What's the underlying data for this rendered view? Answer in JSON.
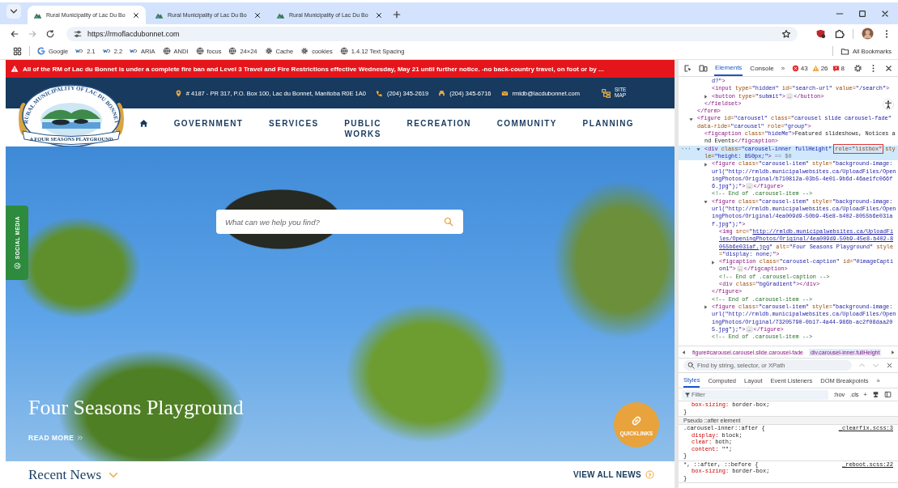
{
  "browser": {
    "tabs": [
      {
        "title": "Rural Municipality of Lac Du Bo",
        "selected": true
      },
      {
        "title": "Rural Municipality of Lac Du Bo",
        "selected": false
      },
      {
        "title": "Rural Municipality of Lac Du Bo",
        "selected": false
      }
    ],
    "nav": [
      {
        "kind": "back",
        "disabled": false
      },
      {
        "kind": "forward",
        "disabled": true
      },
      {
        "kind": "reload",
        "disabled": false
      }
    ],
    "address": {
      "url": "https://rmoflacdubonnet.com"
    },
    "bookmarks": [
      {
        "kind": "google",
        "label": "Google"
      },
      {
        "kind": "w3c",
        "label": "2.1"
      },
      {
        "kind": "w3c",
        "label": "2.2"
      },
      {
        "kind": "w3c",
        "label": "ARIA"
      },
      {
        "kind": "globe",
        "label": "ANDI"
      },
      {
        "kind": "globe",
        "label": "focus"
      },
      {
        "kind": "globe",
        "label": "24×24"
      },
      {
        "kind": "gear",
        "label": "Cache"
      },
      {
        "kind": "gear",
        "label": "cookies"
      },
      {
        "kind": "globe",
        "label": "1.4.12 Text Spacing"
      }
    ],
    "all_bookmarks": "All Bookmarks"
  },
  "page": {
    "alert": "All of the RM of Lac du Bonnet is under a complete fire ban and Level 3 Travel and Fire Restrictions effective Wednesday, May 21 until further notice. -no back-country travel, on foot or by ...",
    "contact": [
      {
        "kind": "address",
        "text": "# 4187 - PR 317, P.O. Box 100, Lac du Bonnet, Manitoba R0E 1A0"
      },
      {
        "kind": "phone",
        "text": "(204) 345-2619"
      },
      {
        "kind": "fax",
        "text": "(204) 345-6716"
      },
      {
        "kind": "email",
        "text": "rmldb@lacdubonnet.com"
      }
    ],
    "site_map": "SITE MAP",
    "logo": {
      "arc_text": "RURAL MUNICIPALITY OF LAC DU BONNET",
      "banner_text": "A FOUR SEASONS PLAYGROUND"
    },
    "nav": [
      "GOVERNMENT",
      "SERVICES",
      "PUBLIC WORKS",
      "RECREATION",
      "COMMUNITY",
      "PLANNING"
    ],
    "search": {
      "placeholder": "What can we help you find?"
    },
    "social_tab": "SOCIAL MEDIA",
    "slide": {
      "caption": "Four Seasons Playground",
      "link": "READ MORE"
    },
    "quicklinks": "QUICKLINKS",
    "recent_news": "Recent News",
    "view_all": "VIEW ALL NEWS"
  },
  "devtools": {
    "tabs": [
      {
        "label": "Elements",
        "selected": true
      },
      {
        "label": "Console",
        "selected": false
      }
    ],
    "more": "»",
    "counts": [
      {
        "kind": "error",
        "count": "43"
      },
      {
        "kind": "warning",
        "count": "26"
      },
      {
        "kind": "issue",
        "count": "8"
      }
    ],
    "dom": [
      {
        "kind": "partial",
        "selected": false,
        "close": [
          {
            "kind": "tag",
            "text": "</form>"
          }
        ],
        "children": [
          {
            "kind": "partial",
            "selected": false,
            "close": [
              {
                "kind": "tag",
                "text": "</fieldset>"
              }
            ],
            "children": [
              {
                "kind": "leaf",
                "selected": false,
                "open": [
                  {
                    "kind": "val",
                    "text": "d?\""
                  },
                  {
                    "kind": "tag",
                    "text": ">"
                  }
                ]
              },
              {
                "kind": "leaf",
                "selected": false,
                "open": [
                  {
                    "kind": "tag",
                    "text": "<input"
                  },
                  {
                    "kind": "attr",
                    "text": " type="
                  },
                  {
                    "kind": "val",
                    "text": "\"hidden\""
                  },
                  {
                    "kind": "attr",
                    "text": " id="
                  },
                  {
                    "kind": "val",
                    "text": "\"search-url\""
                  },
                  {
                    "kind": "attr",
                    "text": " value="
                  },
                  {
                    "kind": "val",
                    "text": "\"/search\""
                  },
                  {
                    "kind": "tag",
                    "text": ">"
                  }
                ]
              },
              {
                "kind": "parent",
                "expanded": false,
                "selected": false,
                "open": [
                  {
                    "kind": "tag",
                    "text": "<button"
                  },
                  {
                    "kind": "attr",
                    "text": " type="
                  },
                  {
                    "kind": "val",
                    "text": "\"submit\""
                  },
                  {
                    "kind": "tag",
                    "text": ">"
                  },
                  {
                    "kind": "dots",
                    "text": "…"
                  },
                  {
                    "kind": "tag",
                    "text": "</button>"
                  }
                ]
              }
            ]
          }
        ]
      },
      {
        "kind": "parent",
        "expanded": true,
        "selected": false,
        "open": [
          {
            "kind": "tag",
            "text": "<figure"
          },
          {
            "kind": "attr",
            "text": " id="
          },
          {
            "kind": "val",
            "text": "\"carousel\""
          },
          {
            "kind": "attr",
            "text": " class="
          },
          {
            "kind": "val",
            "text": "\"carousel slide carousel-fade\""
          },
          {
            "kind": "attr",
            "text": " data-ride="
          },
          {
            "kind": "val",
            "text": "\"carousel\""
          },
          {
            "kind": "attr",
            "text": " role="
          },
          {
            "kind": "val",
            "text": "\"group\""
          },
          {
            "kind": "tag",
            "text": ">"
          }
        ],
        "children": [
          {
            "kind": "leaf",
            "selected": false,
            "open": [
              {
                "kind": "tag",
                "text": "<figcaption"
              },
              {
                "kind": "attr",
                "text": " class="
              },
              {
                "kind": "val",
                "text": "\"hideMe\""
              },
              {
                "kind": "tag",
                "text": ">"
              },
              {
                "kind": "text",
                "text": "Featured slideshows, Notices and Events"
              },
              {
                "kind": "tag",
                "text": "</figcaption>"
              }
            ]
          },
          {
            "kind": "parent",
            "expanded": true,
            "selected": true,
            "gutter": "···",
            "open": [
              {
                "kind": "tag",
                "text": "<div"
              },
              {
                "kind": "attr",
                "text": " class="
              },
              {
                "kind": "val",
                "text": "\"carousel-inner fullHeight\" "
              },
              {
                "kind": "boxed",
                "text": "role=\"listbox\""
              },
              {
                "kind": "attr",
                "text": " style="
              },
              {
                "kind": "val",
                "text": "\"height: 850px;\""
              },
              {
                "kind": "tag",
                "text": ">"
              },
              {
                "kind": "ref",
                "text": " == $0"
              }
            ],
            "children": [
              {
                "kind": "parent",
                "expanded": false,
                "selected": false,
                "open": [
                  {
                    "kind": "tag",
                    "text": "<figure"
                  },
                  {
                    "kind": "attr",
                    "text": " class="
                  },
                  {
                    "kind": "val",
                    "text": "\"carousel-item\""
                  },
                  {
                    "kind": "attr",
                    "text": " style="
                  },
                  {
                    "kind": "val",
                    "text": "\"background-image: url(\"http://rmldb.municipalwebsites.ca/UploadFiles/OpeningPhotos/Original/b710812a-03b5-4e01-9b6d-46ae1fc066f6.jpg\");\""
                  },
                  {
                    "kind": "tag",
                    "text": ">"
                  },
                  {
                    "kind": "dots",
                    "text": "…"
                  },
                  {
                    "kind": "tag",
                    "text": "</figure>"
                  }
                ]
              },
              {
                "kind": "leaf",
                "selected": false,
                "open": [
                  {
                    "kind": "cmt",
                    "text": "<!-- End of .carousel-item -->"
                  }
                ]
              },
              {
                "kind": "parent",
                "expanded": true,
                "selected": false,
                "open": [
                  {
                    "kind": "tag",
                    "text": "<figure"
                  },
                  {
                    "kind": "attr",
                    "text": " class="
                  },
                  {
                    "kind": "val",
                    "text": "\"carousel-item\""
                  },
                  {
                    "kind": "attr",
                    "text": " style="
                  },
                  {
                    "kind": "val",
                    "text": "\"background-image: url(\"http://rmldb.municipalwebsites.ca/UploadFiles/OpeningPhotos/Original/4ea009d9-50b9-45e8-b402-8055b6e031af.jpg\");\""
                  },
                  {
                    "kind": "tag",
                    "text": ">"
                  }
                ],
                "close": [
                  {
                    "kind": "tag",
                    "text": "</figure>"
                  }
                ],
                "children": [
                  {
                    "kind": "leaf",
                    "selected": false,
                    "open": [
                      {
                        "kind": "tag",
                        "text": "<img"
                      },
                      {
                        "kind": "attr",
                        "text": " src="
                      },
                      {
                        "kind": "val",
                        "text": "\""
                      },
                      {
                        "kind": "link",
                        "text": "http://rmldb.municipalwebsites.ca/UploadFiles/OpeningPhotos/Original/4ea009d9-50b9-45e8-b402-8055b6e031af.jpg"
                      },
                      {
                        "kind": "val",
                        "text": "\""
                      },
                      {
                        "kind": "attr",
                        "text": " alt="
                      },
                      {
                        "kind": "val",
                        "text": "\"Four Seasons Playground\""
                      },
                      {
                        "kind": "attr",
                        "text": " style="
                      },
                      {
                        "kind": "val",
                        "text": "\"display: none;\""
                      },
                      {
                        "kind": "tag",
                        "text": ">"
                      }
                    ]
                  },
                  {
                    "kind": "parent",
                    "expanded": false,
                    "selected": false,
                    "open": [
                      {
                        "kind": "tag",
                        "text": "<figcaption"
                      },
                      {
                        "kind": "attr",
                        "text": " class="
                      },
                      {
                        "kind": "val",
                        "text": "\"carousel-caption\""
                      },
                      {
                        "kind": "attr",
                        "text": " id="
                      },
                      {
                        "kind": "val",
                        "text": "\"#imageCaption1\""
                      },
                      {
                        "kind": "tag",
                        "text": ">"
                      },
                      {
                        "kind": "dots",
                        "text": "…"
                      },
                      {
                        "kind": "tag",
                        "text": "</figcaption>"
                      }
                    ]
                  },
                  {
                    "kind": "leaf",
                    "selected": false,
                    "open": [
                      {
                        "kind": "cmt",
                        "text": "<!-- End of .carousel-caption -->"
                      }
                    ]
                  },
                  {
                    "kind": "leaf",
                    "selected": false,
                    "open": [
                      {
                        "kind": "tag",
                        "text": "<div"
                      },
                      {
                        "kind": "attr",
                        "text": " class="
                      },
                      {
                        "kind": "val",
                        "text": "\"bgGradient\""
                      },
                      {
                        "kind": "tag",
                        "text": "></div>"
                      }
                    ]
                  }
                ]
              },
              {
                "kind": "leaf",
                "selected": false,
                "open": [
                  {
                    "kind": "cmt",
                    "text": "<!-- End of .carousel-item -->"
                  }
                ]
              },
              {
                "kind": "parent",
                "expanded": false,
                "selected": false,
                "open": [
                  {
                    "kind": "tag",
                    "text": "<figure"
                  },
                  {
                    "kind": "attr",
                    "text": " class="
                  },
                  {
                    "kind": "val",
                    "text": "\"carousel-item\""
                  },
                  {
                    "kind": "attr",
                    "text": " style="
                  },
                  {
                    "kind": "val",
                    "text": "\"background-image: url(\"http://rmldb.municipalwebsites.ca/UploadFiles/OpeningPhotos/Original/73205790-0b17-4a44-986b-ac2f08daa205.jpg\");\""
                  },
                  {
                    "kind": "tag",
                    "text": ">"
                  },
                  {
                    "kind": "dots",
                    "text": "…"
                  },
                  {
                    "kind": "tag",
                    "text": "</figure>"
                  }
                ]
              },
              {
                "kind": "leaf",
                "selected": false,
                "open": [
                  {
                    "kind": "cmt",
                    "text": "<!-- End of .carousel-item -->"
                  }
                ]
              }
            ]
          }
        ]
      }
    ],
    "breadcrumbs": [
      {
        "label": "figure#carousel.carousel.slide.carousel-fade",
        "selected": false
      },
      {
        "label": "div.carousel-inner.fullHeight",
        "selected": true
      }
    ],
    "find": {
      "placeholder": "Find by string, selector, or XPath"
    },
    "style_tabs": [
      {
        "label": "Styles",
        "selected": true
      },
      {
        "label": "Computed",
        "selected": false
      },
      {
        "label": "Layout",
        "selected": false
      },
      {
        "label": "Event Listeners",
        "selected": false
      },
      {
        "label": "DOM Breakpoints",
        "selected": false
      }
    ],
    "style_more": "»",
    "filter": {
      "placeholder": "Filter"
    },
    "filter_tools": [
      ":hov",
      ".cls",
      "+"
    ],
    "rules": [
      {
        "kind": "rule",
        "declarations": [
          {
            "property": "box-sizing:",
            "value": "border-box;"
          }
        ],
        "close": "}"
      },
      {
        "kind": "header",
        "text": "Pseudo ::after element"
      },
      {
        "kind": "rule",
        "selector": ".carousel-inner::after {",
        "source": "_clearfix.scss:3",
        "declarations": [
          {
            "property": "display:",
            "value": "block;"
          },
          {
            "property": "clear:",
            "value": "both;"
          },
          {
            "property": "content:",
            "value": "\"\";"
          }
        ],
        "close": "}"
      },
      {
        "kind": "rule",
        "selector": "*, ::after, ::before {",
        "source": "_reboot.scss:22",
        "declarations": [
          {
            "property": "box-sizing:",
            "value": "border-box;"
          }
        ],
        "close": "}"
      }
    ]
  }
}
